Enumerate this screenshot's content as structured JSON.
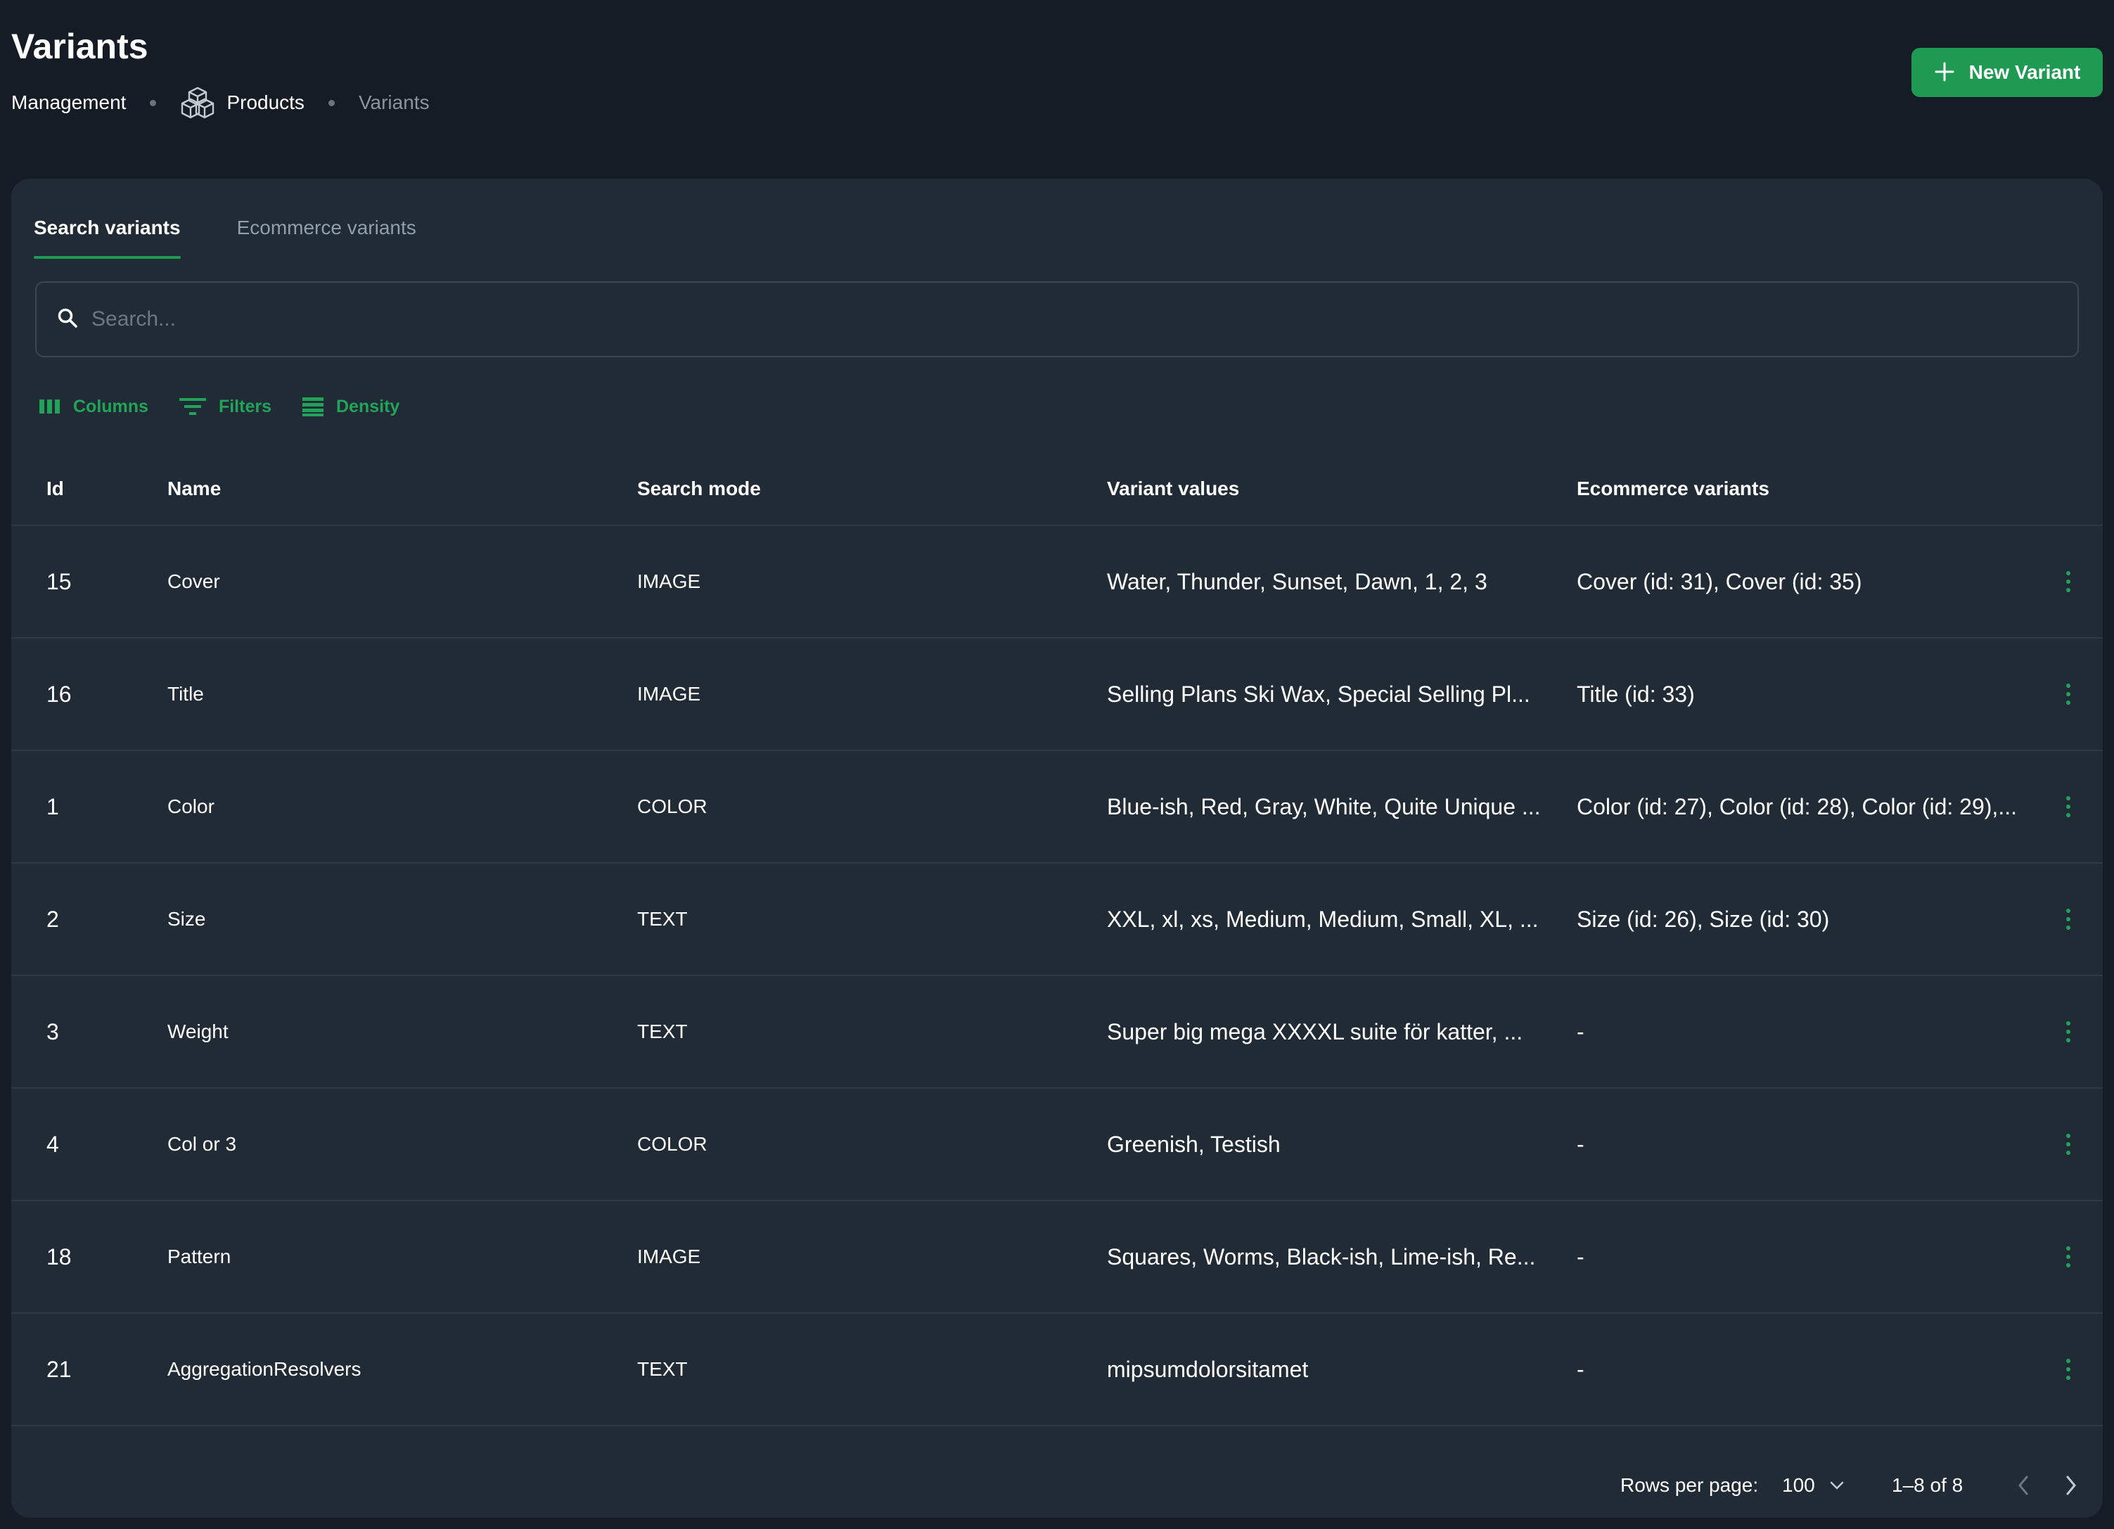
{
  "page": {
    "title": "Variants",
    "breadcrumb": [
      "Management",
      "Products",
      "Variants"
    ],
    "new_button_label": "New Variant"
  },
  "colors": {
    "accent": "#1f9a52",
    "background": "#161c25",
    "card": "#212b36"
  },
  "tabs": [
    {
      "label": "Search variants",
      "active": true
    },
    {
      "label": "Ecommerce variants",
      "active": false
    }
  ],
  "search": {
    "placeholder": "Search..."
  },
  "toolbar": {
    "columns": "Columns",
    "filters": "Filters",
    "density": "Density"
  },
  "table": {
    "headers": [
      "Id",
      "Name",
      "Search mode",
      "Variant values",
      "Ecommerce variants"
    ],
    "rows": [
      [
        "15",
        "Cover",
        "IMAGE",
        "Water, Thunder, Sunset, Dawn, 1, 2, 3",
        "Cover (id: 31), Cover (id: 35)"
      ],
      [
        "16",
        "Title",
        "IMAGE",
        "Selling Plans Ski Wax, Special Selling Pl...",
        "Title (id: 33)"
      ],
      [
        "1",
        "Color",
        "COLOR",
        "Blue-ish, Red, Gray, White, Quite Unique ...",
        "Color (id: 27), Color (id: 28), Color (id: 29),..."
      ],
      [
        "2",
        "Size",
        "TEXT",
        "XXL, xl, xs, Medium, Medium, Small, XL, ...",
        "Size (id: 26), Size (id: 30)"
      ],
      [
        "3",
        "Weight",
        "TEXT",
        "Super big mega XXXXL suite för katter, ...",
        "-"
      ],
      [
        "4",
        "Col or 3",
        "COLOR",
        "Greenish, Testish",
        "-"
      ],
      [
        "18",
        "Pattern",
        "IMAGE",
        "Squares, Worms, Black-ish, Lime-ish, Re...",
        "-"
      ],
      [
        "21",
        "AggregationResolvers",
        "TEXT",
        "mipsumdolorsitamet",
        "-"
      ]
    ]
  },
  "pagination": {
    "rows_per_page_label": "Rows per page:",
    "rows_per_page": "100",
    "range": "1–8 of 8"
  },
  "icons": [
    "products-cube-icon",
    "plus-icon",
    "search-icon",
    "columns-icon",
    "filter-icon",
    "density-icon",
    "more-vertical-icon",
    "chevron-down-icon",
    "chevron-left-icon",
    "chevron-right-icon"
  ]
}
